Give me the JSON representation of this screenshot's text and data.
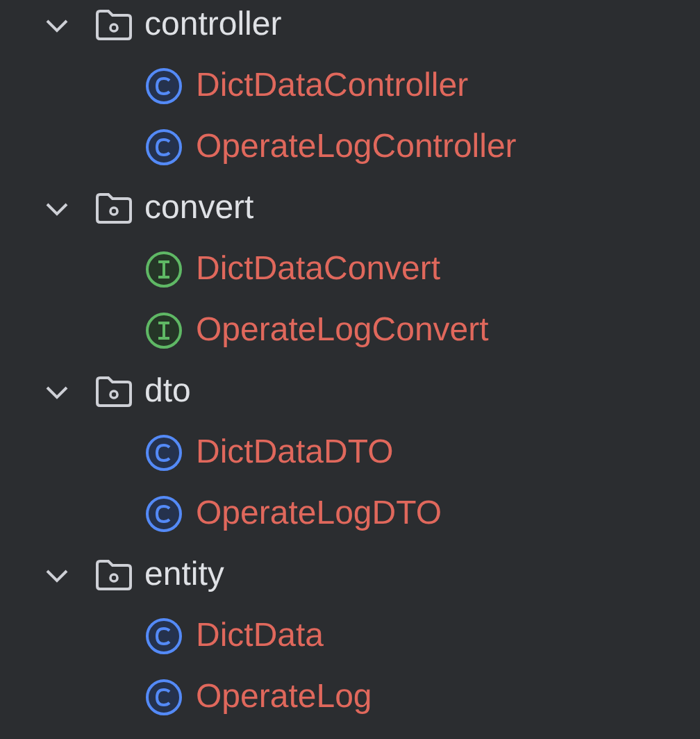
{
  "tree": [
    {
      "name": "controller",
      "kind": "folder",
      "expanded": true,
      "children": [
        {
          "name": "DictDataController",
          "kind": "class"
        },
        {
          "name": "OperateLogController",
          "kind": "class"
        }
      ]
    },
    {
      "name": "convert",
      "kind": "folder",
      "expanded": true,
      "children": [
        {
          "name": "DictDataConvert",
          "kind": "interface"
        },
        {
          "name": "OperateLogConvert",
          "kind": "interface"
        }
      ]
    },
    {
      "name": "dto",
      "kind": "folder",
      "expanded": true,
      "children": [
        {
          "name": "DictDataDTO",
          "kind": "class"
        },
        {
          "name": "OperateLogDTO",
          "kind": "class"
        }
      ]
    },
    {
      "name": "entity",
      "kind": "folder",
      "expanded": true,
      "children": [
        {
          "name": "DictData",
          "kind": "class"
        },
        {
          "name": "OperateLog",
          "kind": "class"
        }
      ]
    }
  ]
}
